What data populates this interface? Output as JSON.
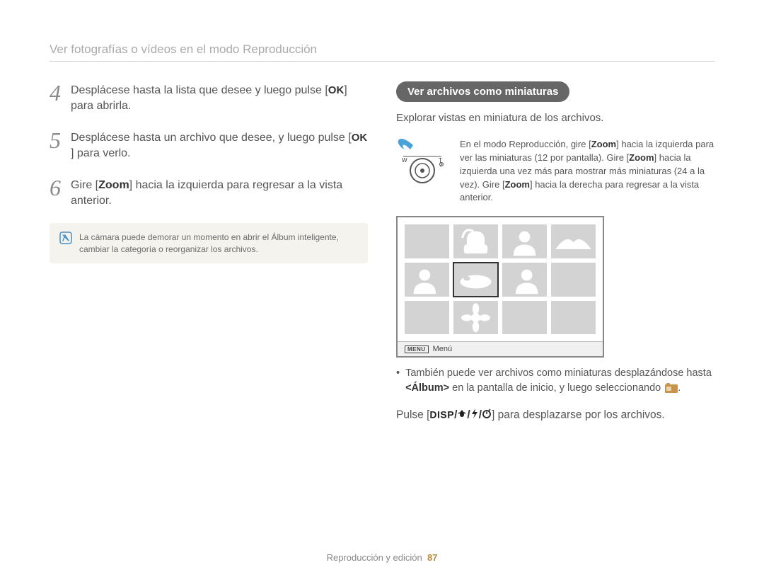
{
  "breadcrumb": "Ver fotografías o vídeos en el modo Reproducción",
  "steps": [
    {
      "num": "4",
      "text_before": "Desplácese hasta la lista que desee y luego pulse [",
      "text_after": "] para abrirla."
    },
    {
      "num": "5",
      "text_before": "Desplácese hasta un archivo que desee, y luego pulse [",
      "text_after": "] para verlo."
    },
    {
      "num": "6",
      "text_before": "Gire [",
      "zoom": "Zoom",
      "text_after": "] hacia la izquierda para regresar a la vista anterior."
    }
  ],
  "ok_label": "OK",
  "note": "La cámara puede demorar un momento en abrir el Álbum inteligente, cambiar la categoría o reorganizar los archivos.",
  "right": {
    "heading": "Ver archivos como miniaturas",
    "subtext": "Explorar vistas en miniatura de los archivos.",
    "dial_text_1": "En el modo Reproducción, gire [",
    "dial_text_2": "] hacia la izquierda para ver las miniaturas (12 por pantalla). Gire [",
    "dial_text_3": "] hacia la izquierda una vez más para mostrar más miniaturas (24 a la vez). Gire [",
    "dial_text_4": "] hacia la derecha para regresar a la vista anterior.",
    "zoom": "Zoom",
    "menu_tag": "MENU",
    "menu_label": "Menú",
    "bullet_1": "También puede ver archivos como miniaturas desplazándose hasta ",
    "album_label": "<Álbum>",
    "bullet_2": " en la pantalla de inicio, y luego seleccionando ",
    "bullet_3": ".",
    "final_before": "Pulse [",
    "disp": "DISP",
    "final_after": "] para desplazarse por los archivos."
  },
  "footer": {
    "label": "Reproducción y edición",
    "page": "87"
  }
}
